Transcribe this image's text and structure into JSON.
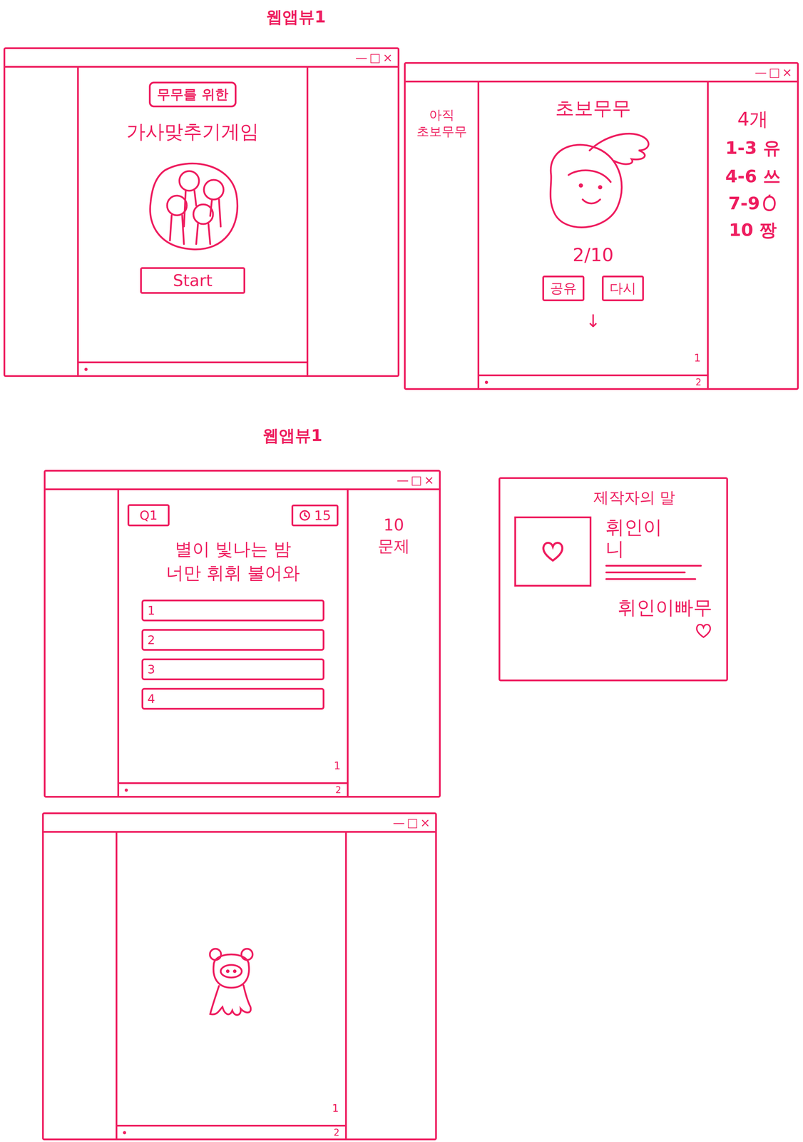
{
  "headings": [
    "웹앱뷰1",
    "웹앱뷰1"
  ],
  "window_controls": [
    "—",
    "□",
    "×"
  ],
  "start_screen": {
    "badge": "무무를 위한",
    "title": "가사맞추기게임",
    "button": "Start"
  },
  "result_screen": {
    "side_note": "아직 초보무무",
    "title": "초보무무",
    "score": "2/10",
    "buttons": [
      "공유",
      "다시"
    ],
    "arrow": "↓",
    "notes": {
      "count": "4개",
      "ranks": [
        {
          "text": "1-3 유",
          "kind": "text"
        },
        {
          "text": "4-6 쓰",
          "kind": "text"
        },
        {
          "text": "7-9",
          "kind": "icon"
        },
        {
          "text": "10 짱",
          "kind": "text"
        }
      ]
    },
    "scroll_mark": "1",
    "page_mark": "2"
  },
  "quiz_screen": {
    "question_no": "Q1",
    "timer": "15",
    "question": [
      "별이 빛나는 밤",
      "너만 휘휘 불어와"
    ],
    "options": [
      "1",
      "2",
      "3",
      "4"
    ],
    "side_note": [
      "10",
      "문제"
    ],
    "scroll_mark": "1",
    "page_mark": "2"
  },
  "creator_card": {
    "title": "제작자의 말",
    "name": [
      "휘인이",
      "니"
    ],
    "sign": "휘인이빠무"
  },
  "loading_screen": {
    "scroll_mark": "1",
    "page_mark": "2"
  }
}
